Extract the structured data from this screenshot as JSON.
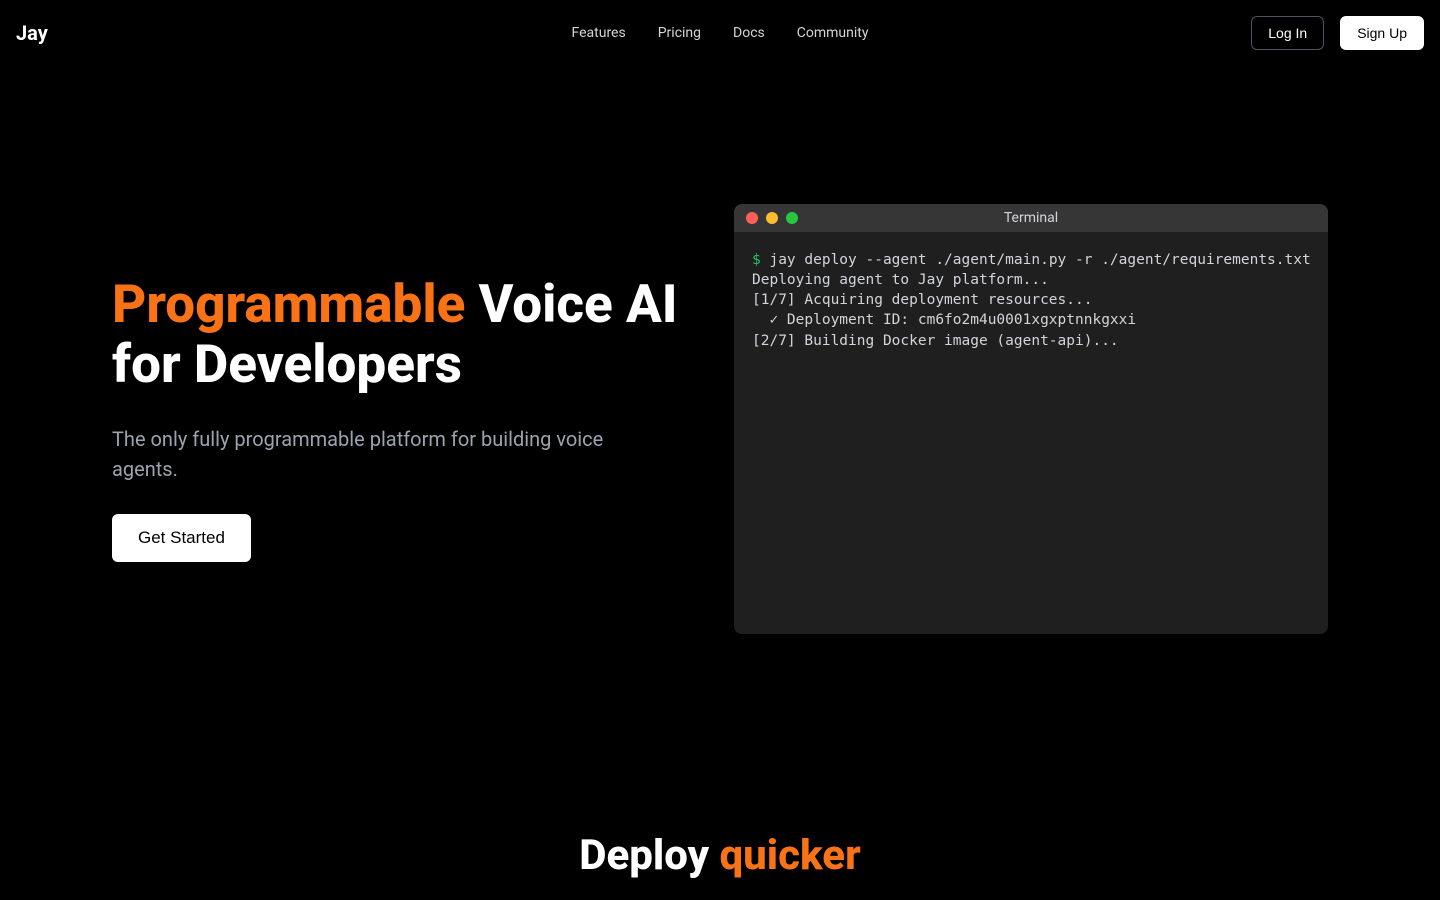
{
  "nav": {
    "brand": "Jay",
    "links": [
      "Features",
      "Pricing",
      "Docs",
      "Community"
    ],
    "login": "Log In",
    "signup": "Sign Up"
  },
  "hero": {
    "title_accent": "Programmable",
    "title_rest": " Voice AI for Developers",
    "subtitle": "The only fully programmable platform for building voice agents.",
    "cta": "Get Started"
  },
  "terminal": {
    "title": "Terminal",
    "prompt": "$",
    "command": " jay deploy --agent ./agent/main.py -r ./agent/requirements.txt",
    "output": "\nDeploying agent to Jay platform...\n[1/7] Acquiring deployment resources...\n  ✓ Deployment ID: cm6fo2m4u0001xgxptnnkgxxi\n[2/7] Building Docker image (agent-api)..."
  },
  "second": {
    "prefix": "Deploy ",
    "accent": "quicker"
  }
}
